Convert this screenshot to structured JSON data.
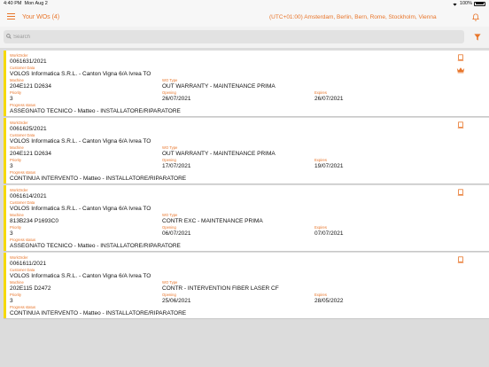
{
  "status_bar": {
    "time": "4:40 PM",
    "date": "Mon Aug 2",
    "battery": "100%",
    "wifi_icon": "wifi-icon"
  },
  "nav": {
    "title": "Your WOs (4)",
    "timezone": "(UTC+01:00) Amsterdam, Berlin, Bern, Rome, Stockholm, Vienna",
    "menu_icon": "hamburger-icon",
    "bell_icon": "bell-icon"
  },
  "search": {
    "placeholder": "Search",
    "value": ""
  },
  "labels": {
    "workorder": "WorkOrder",
    "customer": "Customer Data",
    "machine": "Machine",
    "wo_type": "WO Type",
    "priority": "Priority",
    "opening": "Opening",
    "expires": "Expires",
    "progress": "Progress status"
  },
  "colors": {
    "accent": "#e8752a",
    "status_bar": "#f5d90a",
    "background": "#dcdcdc"
  },
  "workorders": [
    {
      "number": "0061631/2021",
      "customer": "VOLOS Informatica S.R.L. - Canton Vigna 6/A Ivrea TO",
      "machine": "204E121 D2634",
      "wo_type": "OUT WARRANTY - MAINTENANCE PRIMA",
      "priority": "3",
      "opening": "26/07/2021",
      "expires": "26/07/2021",
      "progress": "ASSEGNATO TECNICO - Matteo - INSTALLATORE/RIPARATORE",
      "icon": "document-icon",
      "badge_icon": "crown-icon"
    },
    {
      "number": "0061625/2021",
      "customer": "VOLOS Informatica S.R.L. - Canton Vigna 6/A Ivrea TO",
      "machine": "204E121 D2634",
      "wo_type": "OUT WARRANTY - MAINTENANCE PRIMA",
      "priority": "3",
      "opening": "17/07/2021",
      "expires": "19/07/2021",
      "progress": "CONTINUA INTERVENTO - Matteo - INSTALLATORE/RIPARATORE",
      "icon": "document-icon"
    },
    {
      "number": "0061614/2021",
      "customer": "VOLOS Informatica S.R.L. - Canton Vigna 6/A Ivrea TO",
      "machine": "813B234 P1693C0",
      "wo_type": "CONTR EXC - MAINTENANCE PRIMA",
      "priority": "3",
      "opening": "06/07/2021",
      "expires": "07/07/2021",
      "progress": "ASSEGNATO TECNICO - Matteo - INSTALLATORE/RIPARATORE",
      "icon": "document-icon"
    },
    {
      "number": "0061611/2021",
      "customer": "VOLOS Informatica S.R.L. - Canton Vigna 6/A Ivrea TO",
      "machine": "202E115 D2472",
      "wo_type": "CONTR - INTERVENTION FIBER LASER CF",
      "priority": "3",
      "opening": "25/06/2021",
      "expires": "28/05/2022",
      "progress": "CONTINUA INTERVENTO - Matteo - INSTALLATORE/RIPARATORE",
      "icon": "document-icon"
    }
  ]
}
